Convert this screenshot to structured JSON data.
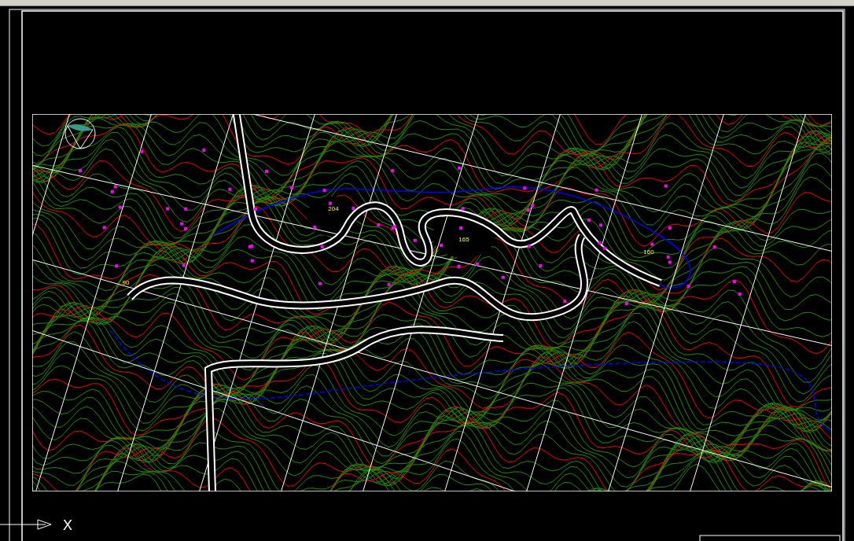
{
  "elevation_labels": [
    {
      "text": "204"
    },
    {
      "text": "165"
    },
    {
      "text": "160"
    },
    {
      "text": "90"
    }
  ],
  "ucs_icon": {
    "axis_label": "X"
  }
}
